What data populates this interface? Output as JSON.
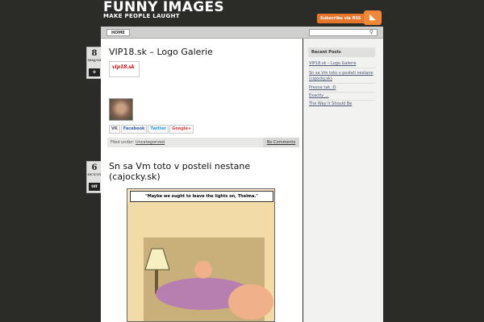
{
  "site": {
    "title": "FUNNY IMAGES",
    "tagline": "MAKE PEOPLE LAUGHT",
    "rss_label": "Subscribe via RSS"
  },
  "nav": {
    "home": "HOME"
  },
  "posts": [
    {
      "title": "VIP18.sk – Logo Galerie",
      "day": "8",
      "month": "MAJ/10",
      "comments_count": "0",
      "logo_text": "vip18.sk"
    },
    {
      "title": "Sn sa Vm toto v posteli nestane (cajocky.sk)",
      "day": "6",
      "month": "OCT/15",
      "comments_count": "0ff"
    }
  ],
  "share": {
    "vk": "VK",
    "facebook": "Facebook",
    "twitter": "Twitter",
    "google": "Google+"
  },
  "filed": {
    "label": "Filed under:",
    "category": "Uncategorized",
    "comments": "No Comments"
  },
  "cartoon": {
    "caption": "\"Maybe we ought to leave the lights on, Thelma.\""
  },
  "sidebar": {
    "heading": "Recent Posts",
    "links": [
      "VIP18.sk – Logo Galerie",
      "Sn sa Vm toto v posteli nestane (cajocky.sk)",
      "Presne tak :D",
      "Exactly ...",
      "The Way It Should Be"
    ]
  },
  "colors": {
    "background": "#2b2b28",
    "accent": "#e5762a",
    "content": "#ffffff"
  }
}
